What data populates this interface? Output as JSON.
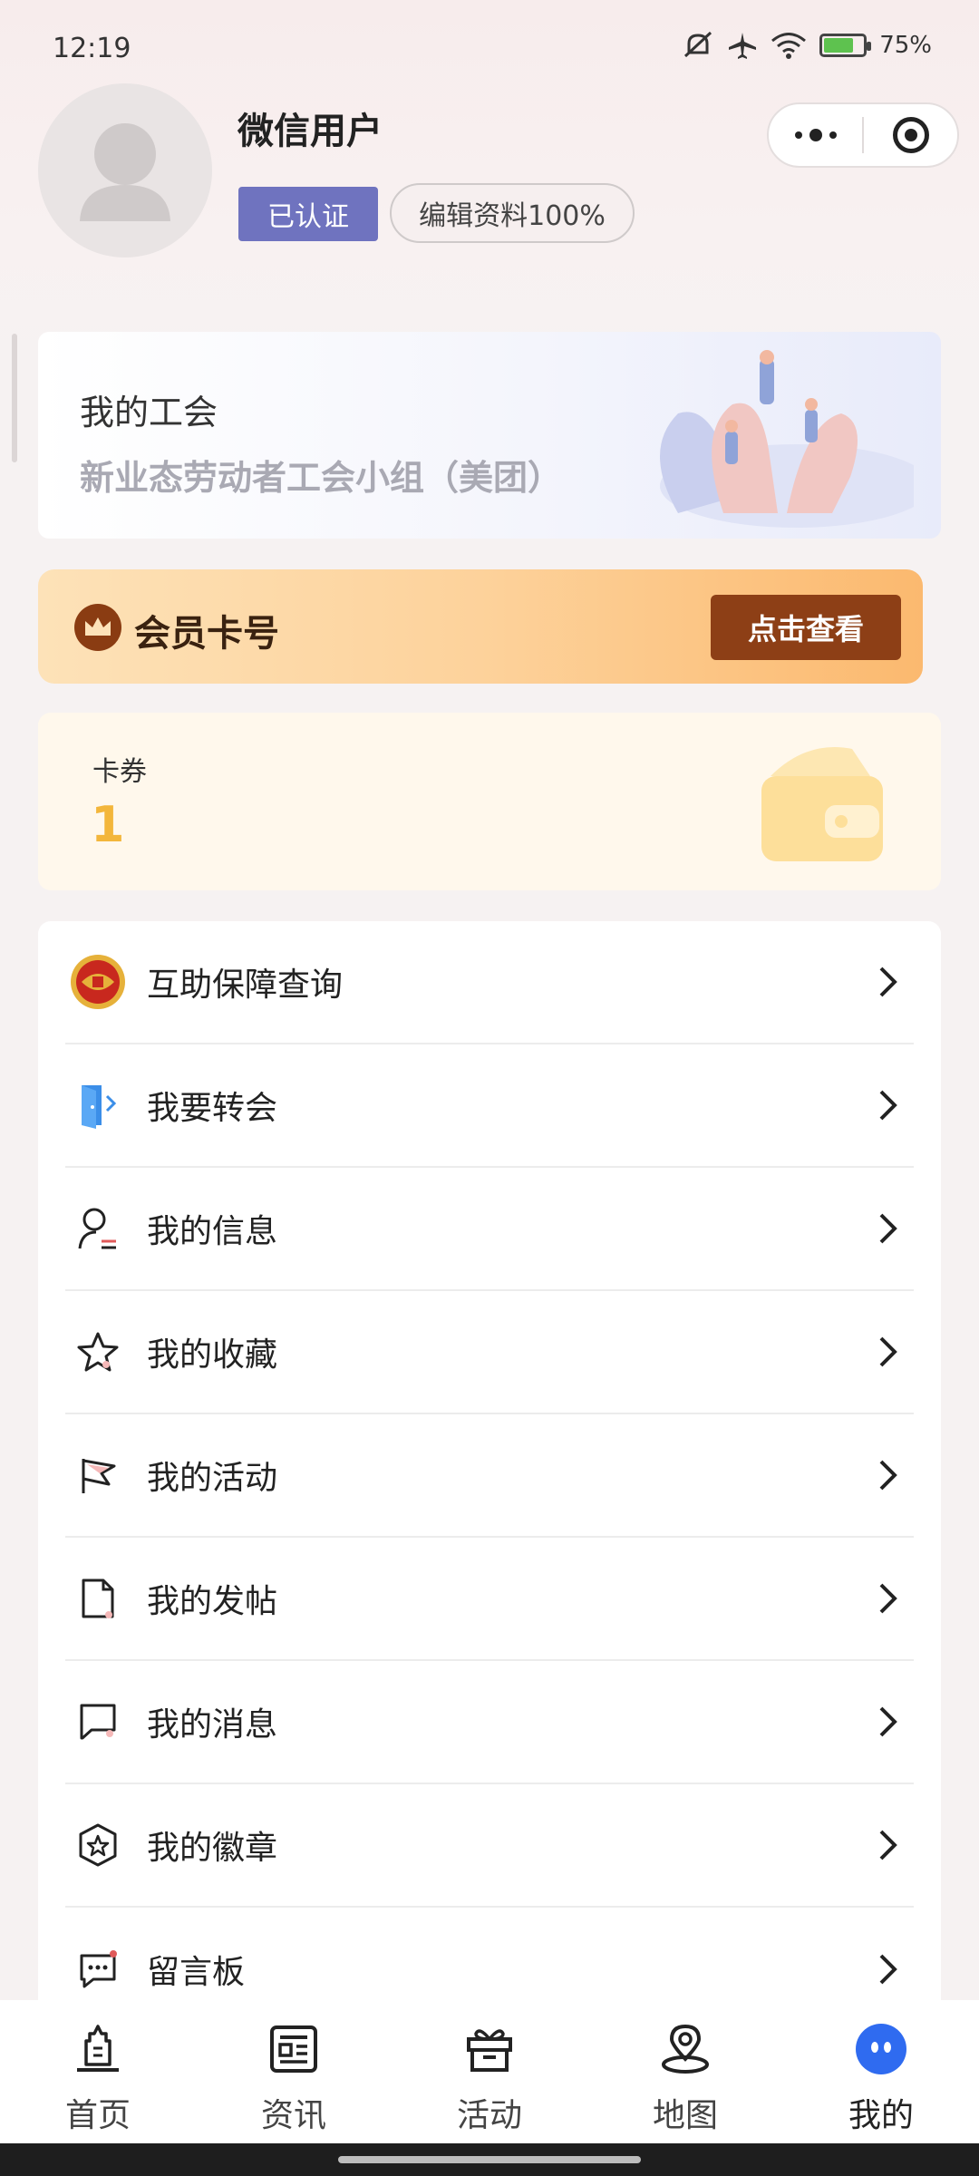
{
  "status_bar": {
    "time": "12:19",
    "signal": "6",
    "battery": "75%"
  },
  "profile": {
    "username": "微信用户",
    "verified_label": "已认证",
    "edit_label": "编辑资料100%"
  },
  "union": {
    "title": "我的工会",
    "name": "新业态劳动者工会小组（美团）"
  },
  "member_card": {
    "title": "会员卡号",
    "button": "点击查看"
  },
  "coupons": {
    "label": "卡券",
    "count": "1"
  },
  "menu": [
    {
      "label": "互助保障查询",
      "icon": "mutual-aid-emblem-icon"
    },
    {
      "label": "我要转会",
      "icon": "transfer-door-icon"
    },
    {
      "label": "我的信息",
      "icon": "user-info-icon"
    },
    {
      "label": "我的收藏",
      "icon": "star-icon"
    },
    {
      "label": "我的活动",
      "icon": "flag-icon"
    },
    {
      "label": "我的发帖",
      "icon": "document-icon"
    },
    {
      "label": "我的消息",
      "icon": "message-icon"
    },
    {
      "label": "我的徽章",
      "icon": "badge-icon"
    },
    {
      "label": "留言板",
      "icon": "comment-board-icon"
    }
  ],
  "tabs": [
    {
      "label": "首页",
      "icon": "home-tower-icon"
    },
    {
      "label": "资讯",
      "icon": "news-icon"
    },
    {
      "label": "活动",
      "icon": "gift-icon"
    },
    {
      "label": "地图",
      "icon": "map-pin-icon"
    },
    {
      "label": "我的",
      "icon": "mine-icon",
      "active": true
    }
  ],
  "colors": {
    "verified_badge": "#6f73bf",
    "member_button": "#8d3f16",
    "coupon_count": "#f3b63b",
    "active_tab": "#2f6bf0"
  }
}
